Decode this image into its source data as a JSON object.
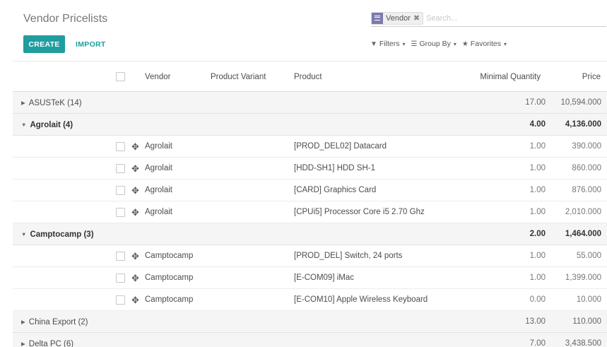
{
  "title": "Vendor Pricelists",
  "search": {
    "facet_label": "Vendor",
    "facet_remove": "✖",
    "placeholder": "Search..."
  },
  "buttons": {
    "create": "CREATE",
    "import": "IMPORT"
  },
  "search_options": {
    "filters": "Filters",
    "group_by": "Group By",
    "favorites": "Favorites"
  },
  "columns": {
    "vendor": "Vendor",
    "variant": "Product Variant",
    "product": "Product",
    "min_qty": "Minimal Quantity",
    "price": "Price"
  },
  "groups": [
    {
      "label": "ASUSTeK (14)",
      "qty": "17.00",
      "price": "10,594.000",
      "expanded": false,
      "rows": []
    },
    {
      "label": "Agrolait (4)",
      "qty": "4.00",
      "price": "4,136.000",
      "expanded": true,
      "rows": [
        {
          "vendor": "Agrolait",
          "product": "[PROD_DEL02] Datacard",
          "qty": "1.00",
          "price": "390.000"
        },
        {
          "vendor": "Agrolait",
          "product": "[HDD-SH1] HDD SH-1",
          "qty": "1.00",
          "price": "860.000"
        },
        {
          "vendor": "Agrolait",
          "product": "[CARD] Graphics Card",
          "qty": "1.00",
          "price": "876.000"
        },
        {
          "vendor": "Agrolait",
          "product": "[CPUi5] Processor Core i5 2.70 Ghz",
          "qty": "1.00",
          "price": "2,010.000"
        }
      ]
    },
    {
      "label": "Camptocamp (3)",
      "qty": "2.00",
      "price": "1,464.000",
      "expanded": true,
      "rows": [
        {
          "vendor": "Camptocamp",
          "product": "[PROD_DEL] Switch, 24 ports",
          "qty": "1.00",
          "price": "55.000"
        },
        {
          "vendor": "Camptocamp",
          "product": "[E-COM09] iMac",
          "qty": "1.00",
          "price": "1,399.000"
        },
        {
          "vendor": "Camptocamp",
          "product": "[E-COM10] Apple Wireless Keyboard",
          "qty": "0.00",
          "price": "10.000"
        }
      ]
    },
    {
      "label": "China Export (2)",
      "qty": "13.00",
      "price": "110.000",
      "expanded": false,
      "rows": []
    },
    {
      "label": "Delta PC (6)",
      "qty": "7.00",
      "price": "3,438.500",
      "expanded": false,
      "rows": []
    }
  ],
  "colors": {
    "accent": "#1f9d9f",
    "facet": "#7c7bad"
  }
}
